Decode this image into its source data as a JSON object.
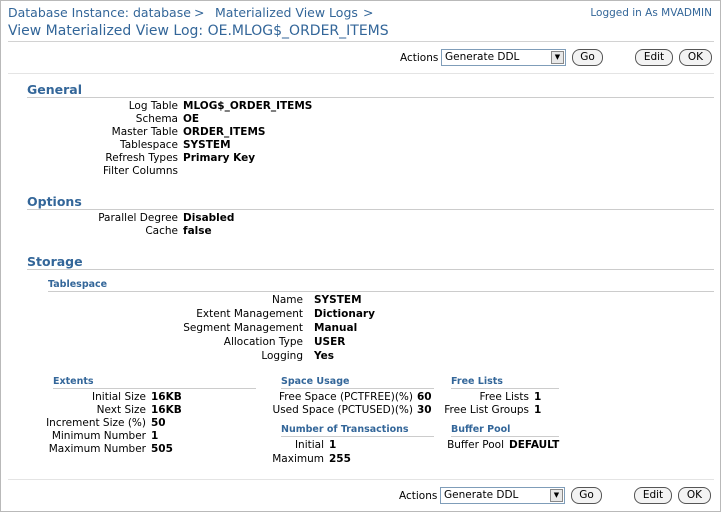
{
  "header": {
    "breadcrumb": [
      "Database Instance: database",
      "Materialized View Logs"
    ],
    "breadcrumb_sep": ">",
    "logged_in": "Logged in As MVADMIN",
    "title": "View Materialized View Log: OE.MLOG$_ORDER_ITEMS"
  },
  "toolbar": {
    "actions_label": "Actions",
    "actions_selected": "Generate DDL",
    "go_label": "Go",
    "edit_label": "Edit",
    "ok_label": "OK"
  },
  "general": {
    "heading": "General",
    "rows": [
      {
        "label": "Log Table",
        "value": "MLOG$_ORDER_ITEMS"
      },
      {
        "label": "Schema",
        "value": "OE"
      },
      {
        "label": "Master Table",
        "value": "ORDER_ITEMS"
      },
      {
        "label": "Tablespace",
        "value": "SYSTEM"
      },
      {
        "label": "Refresh Types",
        "value": "Primary Key"
      },
      {
        "label": "Filter Columns",
        "value": ""
      }
    ]
  },
  "options": {
    "heading": "Options",
    "rows": [
      {
        "label": "Parallel Degree",
        "value": "Disabled"
      },
      {
        "label": "Cache",
        "value": "false"
      }
    ]
  },
  "storage": {
    "heading": "Storage",
    "tablespace": {
      "heading": "Tablespace",
      "rows": [
        {
          "label": "Name",
          "value": "SYSTEM"
        },
        {
          "label": "Extent Management",
          "value": "Dictionary"
        },
        {
          "label": "Segment Management",
          "value": "Manual"
        },
        {
          "label": "Allocation Type",
          "value": "USER"
        },
        {
          "label": "Logging",
          "value": "Yes"
        }
      ]
    },
    "extents": {
      "heading": "Extents",
      "rows": [
        {
          "label": "Initial Size",
          "value": "16KB"
        },
        {
          "label": "Next Size",
          "value": "16KB"
        },
        {
          "label": "Increment Size (%)",
          "value": "50"
        },
        {
          "label": "Minimum Number",
          "value": "1"
        },
        {
          "label": "Maximum Number",
          "value": "505"
        }
      ]
    },
    "space_usage": {
      "heading": "Space Usage",
      "rows": [
        {
          "label": "Free Space (PCTFREE)(%)",
          "value": "60"
        },
        {
          "label": "Used Space (PCTUSED)(%)",
          "value": "30"
        }
      ]
    },
    "transactions": {
      "heading": "Number of Transactions",
      "rows": [
        {
          "label": "Initial",
          "value": "1"
        },
        {
          "label": "Maximum",
          "value": "255"
        }
      ]
    },
    "free_lists": {
      "heading": "Free Lists",
      "rows": [
        {
          "label": "Free Lists",
          "value": "1"
        },
        {
          "label": "Free List Groups",
          "value": "1"
        }
      ]
    },
    "buffer_pool": {
      "heading": "Buffer Pool",
      "rows": [
        {
          "label": "Buffer Pool",
          "value": "DEFAULT"
        }
      ]
    }
  }
}
